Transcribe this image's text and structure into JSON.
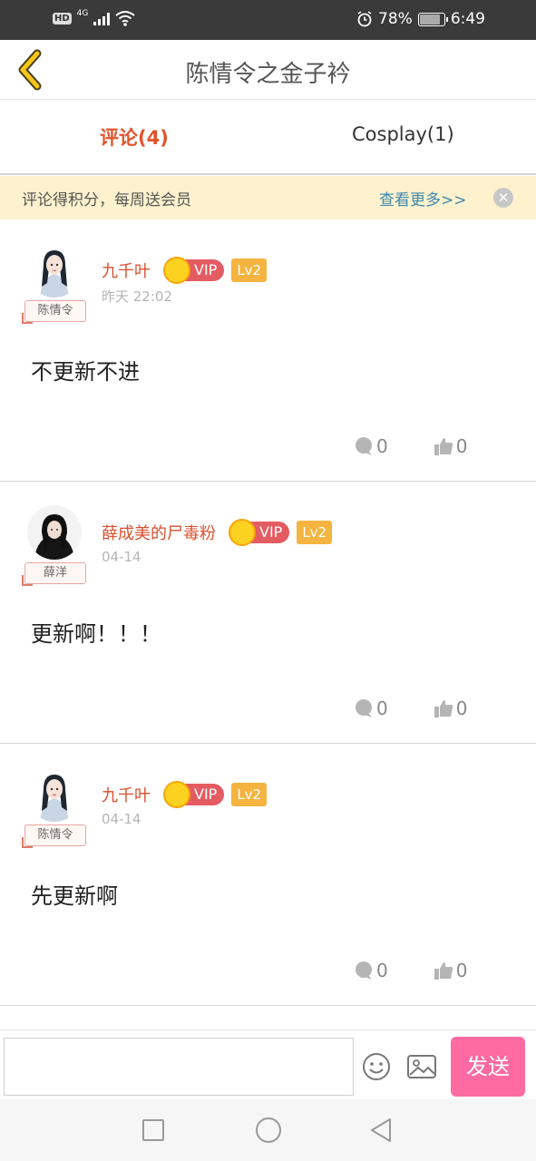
{
  "status_bar": {
    "network_badge": "HD",
    "network_type": "4G",
    "battery": "78%",
    "battery_level": 0.78,
    "time": "6:49",
    "icons": [
      "signal-icon",
      "wifi-icon",
      "alarm-icon",
      "battery-icon"
    ]
  },
  "header": {
    "title": "陈情令之金子衿",
    "back_icon": "chevron-left-icon"
  },
  "tabs": [
    {
      "label": "评论(4)",
      "active": true
    },
    {
      "label": "Cosplay(1)",
      "active": false
    }
  ],
  "notice": {
    "text": "评论得积分，每周送会员",
    "more": "查看更多>>",
    "close_icon": "close-icon"
  },
  "comments": [
    {
      "username": "九千叶",
      "vip": "VIP",
      "level": "Lv2",
      "time": "昨天 22:02",
      "tag": "陈情令",
      "body": "不更新不进",
      "reply_count": "0",
      "like_count": "0"
    },
    {
      "username": "薛成美的尸毒粉",
      "vip": "VIP",
      "level": "Lv2",
      "time": "04-14",
      "tag": "薛洋",
      "body": "更新啊！！！",
      "reply_count": "0",
      "like_count": "0"
    },
    {
      "username": "九千叶",
      "vip": "VIP",
      "level": "Lv2",
      "time": "04-14",
      "tag": "陈情令",
      "body": "先更新啊",
      "reply_count": "0",
      "like_count": "0"
    }
  ],
  "input_bar": {
    "placeholder": "",
    "send_label": "发送",
    "emoji_icon": "emoji-icon",
    "image_icon": "image-icon"
  },
  "colors": {
    "accent": "#e2542c",
    "send": "#fd6ba2",
    "vip": "#e45b62",
    "level": "#f4b43f",
    "notice_bg": "#fdf2cd",
    "link": "#3d88b0",
    "back_arrow": "#f5c518"
  }
}
